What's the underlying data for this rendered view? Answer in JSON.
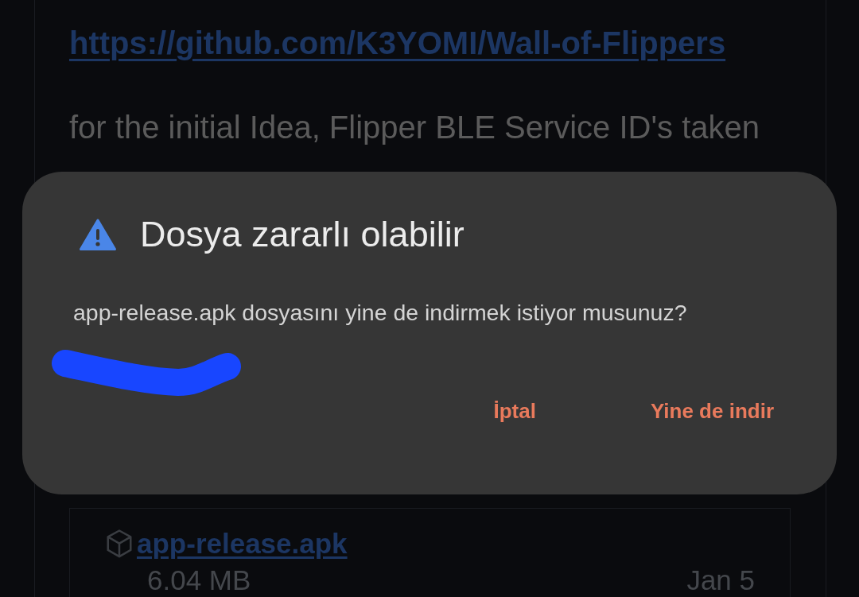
{
  "readme": {
    "link": "https://github.com/K3YOMI/Wall-of-Flippers",
    "paragraph": "for the initial Idea, Flipper BLE Service ID's taken"
  },
  "release_asset": {
    "name": "app-release.apk",
    "size": "6.04 MB",
    "date": "Jan 5"
  },
  "dialog": {
    "title": "Dosya zararlı olabilir",
    "message": "app-release.apk dosyasını yine de indirmek istiyor musunuz?",
    "buttons": [
      "İptal",
      "Yine de indir"
    ]
  }
}
